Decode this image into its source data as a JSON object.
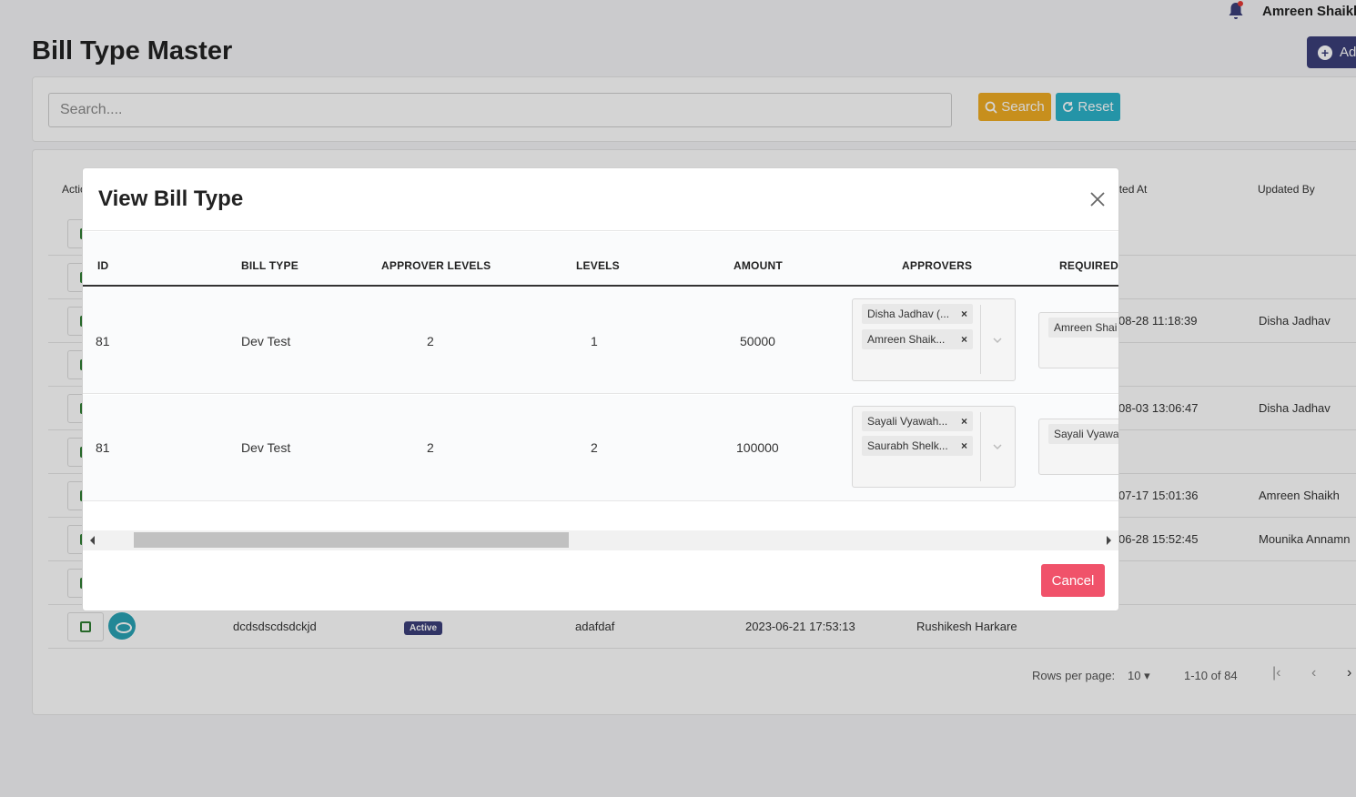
{
  "header": {
    "user_name": "Amreen Shaikh"
  },
  "page": {
    "title": "Bill Type Master",
    "add_label": "Add",
    "search_placeholder": "Search....",
    "search_label": "Search",
    "reset_label": "Reset"
  },
  "background_table": {
    "headers": {
      "action": "Action",
      "updated_at": "Updated At",
      "updated_by": "Updated By"
    },
    "rows": [
      {
        "updated_at": "",
        "updated_by": ""
      },
      {
        "updated_at": "",
        "updated_by": ""
      },
      {
        "updated_at": "08-28 11:18:39",
        "updated_by": "Disha Jadhav"
      },
      {
        "updated_at": "",
        "updated_by": ""
      },
      {
        "updated_at": "08-03 13:06:47",
        "updated_by": "Disha Jadhav"
      },
      {
        "updated_at": "",
        "updated_by": ""
      },
      {
        "updated_at": "07-17 15:01:36",
        "updated_by": "Amreen Shaikh"
      },
      {
        "updated_at": "06-28 15:52:45",
        "updated_by": "Mounika Annamn"
      },
      {
        "updated_at": "",
        "updated_by": ""
      }
    ],
    "last_row": {
      "name": "dcdsdscdsdckjd",
      "status": "Active",
      "description": "adafdaf",
      "created_at": "2023-06-21 17:53:13",
      "created_by": "Rushikesh Harkare"
    },
    "pagination": {
      "rows_per_page_label": "Rows per page:",
      "rows_per_page": "10",
      "range": "1-10 of 84"
    }
  },
  "modal": {
    "title": "View Bill Type",
    "columns": {
      "id": "ID",
      "bill_type": "BILL TYPE",
      "approver_levels": "APPROVER LEVELS",
      "levels": "LEVELS",
      "amount": "AMOUNT",
      "approvers": "APPROVERS",
      "required": "REQUIRED A"
    },
    "rows": [
      {
        "id": "81",
        "bill_type": "Dev Test",
        "approver_levels": "2",
        "levels": "1",
        "amount": "50000",
        "approvers": [
          "Disha Jadhav (...",
          "Amreen Shaik..."
        ],
        "required": [
          "Amreen Shai"
        ]
      },
      {
        "id": "81",
        "bill_type": "Dev Test",
        "approver_levels": "2",
        "levels": "2",
        "amount": "100000",
        "approvers": [
          "Sayali Vyawah...",
          "Saurabh Shelk..."
        ],
        "required": [
          "Sayali Vyawa"
        ]
      }
    ],
    "cancel_label": "Cancel",
    "chip_remove": "×"
  }
}
